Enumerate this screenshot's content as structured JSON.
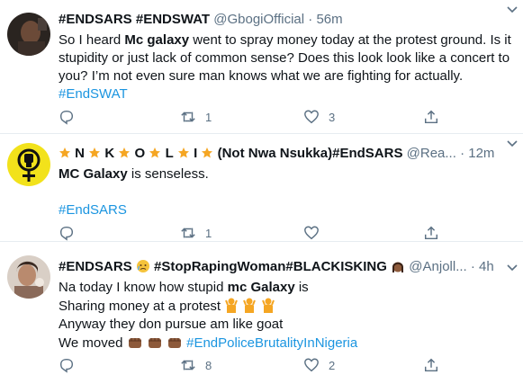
{
  "tweets": [
    {
      "display_name": "#ENDSARS #ENDSWAT",
      "handle": "@GbogiOfficial",
      "time": "56m",
      "lines": [
        [
          "So I heard ",
          "Mc galaxy",
          " went to spray money today at the protest ground. Is it"
        ],
        "stupidity or just lack of common sense? Does this look look like a concert to",
        "you? I’m not even sure man knows what we are fighting for actually.",
        "#EndSWAT"
      ],
      "reply_count": "",
      "retweet_count": "1",
      "like_count": "3"
    },
    {
      "display_name_parts": [
        "N",
        "K",
        "O",
        "L",
        "I",
        "(Not Nwa Nsukka)#EndSARS"
      ],
      "handle": "@Rea...",
      "time": "12m",
      "lines": [
        [
          "MC Galaxy",
          " is senseless."
        ],
        "#EndSARS"
      ],
      "reply_count": "",
      "retweet_count": "1",
      "like_count": ""
    },
    {
      "display_name_parts": [
        "#ENDSARS",
        "#StopRapingWoman#BLACKISKING",
        "@Anjoll..."
      ],
      "time": "4h",
      "lines": [
        [
          "Na today I know how stupid ",
          "mc Galaxy",
          " is"
        ],
        "Sharing money at a protest",
        "Anyway they don pursue am like goat",
        "We moved",
        "#EndPoliceBrutalityInNigeria"
      ],
      "reply_count": "",
      "retweet_count": "8",
      "like_count": "2"
    }
  ],
  "separator": "·",
  "colors": {
    "link": "#1b95e0",
    "muted": "#5b7083",
    "star": "#f5a623",
    "avatar_yellow": "#f2e21b"
  },
  "icons": [
    "reply-icon",
    "retweet-icon",
    "like-icon",
    "share-icon",
    "caret-down-icon",
    "star-emoji",
    "fist-emoji",
    "raising-hands-emoji",
    "crying-face-emoji",
    "woman-emoji"
  ]
}
